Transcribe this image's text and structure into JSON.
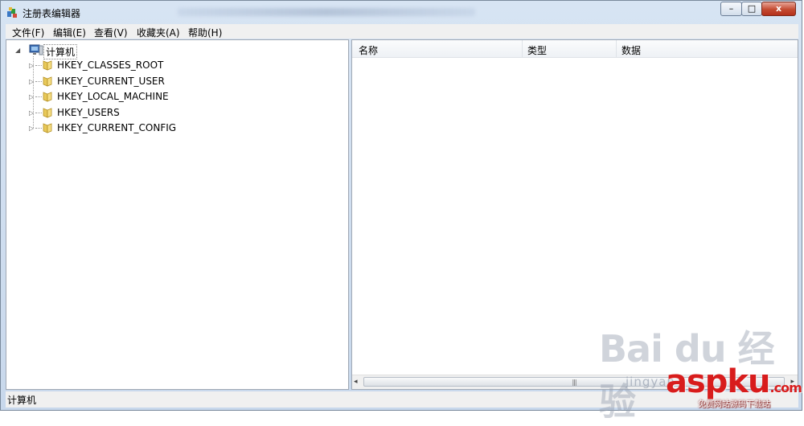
{
  "window": {
    "title": "注册表编辑器",
    "controls": {
      "minimize": "–",
      "maximize": "□",
      "close": "x"
    }
  },
  "menu": [
    {
      "label": "文件(F)"
    },
    {
      "label": "编辑(E)"
    },
    {
      "label": "查看(V)"
    },
    {
      "label": "收藏夹(A)"
    },
    {
      "label": "帮助(H)"
    }
  ],
  "tree": {
    "root": "计算机",
    "expander_root": "◢",
    "expander_child": "▷",
    "children": [
      "HKEY_CLASSES_ROOT",
      "HKEY_CURRENT_USER",
      "HKEY_LOCAL_MACHINE",
      "HKEY_USERS",
      "HKEY_CURRENT_CONFIG"
    ]
  },
  "list": {
    "columns": [
      "名称",
      "类型",
      "数据"
    ],
    "scroll_left": "◂",
    "scroll_right": "▸",
    "scroll_grip": "|||"
  },
  "status": {
    "path": "计算机"
  },
  "watermarks": {
    "baidu": "Bai du 经验",
    "jingyan": "jingyan",
    "aspku": "aspku",
    "aspku_suffix": ".com",
    "aspku_sub": "免费网站源码下载站"
  },
  "colors": {
    "folder": "#e8c95a",
    "close_button": "#c44b31",
    "watermark_red": "#d81c1c"
  }
}
